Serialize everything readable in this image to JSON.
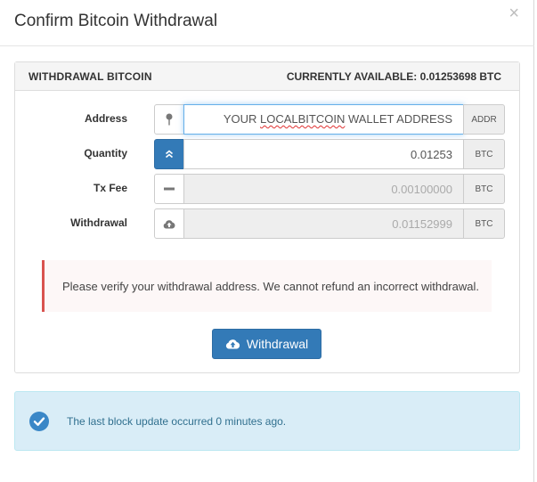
{
  "modal": {
    "title": "Confirm Bitcoin Withdrawal",
    "close_label": "×"
  },
  "panel": {
    "heading_left": "WITHDRAWAL BITCOIN",
    "heading_right": "CURRENTLY AVAILABLE: 0.01253698 BTC"
  },
  "form": {
    "address": {
      "label": "Address",
      "value_before": "YOUR ",
      "value_misspelled": "LOCALBITCOIN",
      "value_after": " WALLET ADDRESS",
      "unit": "ADDR",
      "icon": "map-pin-icon"
    },
    "quantity": {
      "label": "Quantity",
      "value": "0.01253",
      "unit": "BTC",
      "icon": "chevron-up-double-icon"
    },
    "txfee": {
      "label": "Tx Fee",
      "value": "0.00100000",
      "unit": "BTC",
      "icon": "minus-icon"
    },
    "withdrawal": {
      "label": "Withdrawal",
      "value": "0.01152999",
      "unit": "BTC",
      "icon": "cloud-upload-icon"
    }
  },
  "alert": {
    "text": "Please verify your withdrawal address. We cannot refund an incorrect withdrawal.",
    "color": "#d9534f"
  },
  "action": {
    "button_label": "Withdrawal",
    "icon": "cloud-upload-icon",
    "color": "#337ab7"
  },
  "info": {
    "text": "The last block update occurred 0 minutes ago.",
    "icon": "check-circle-icon",
    "color": "#31708f"
  }
}
